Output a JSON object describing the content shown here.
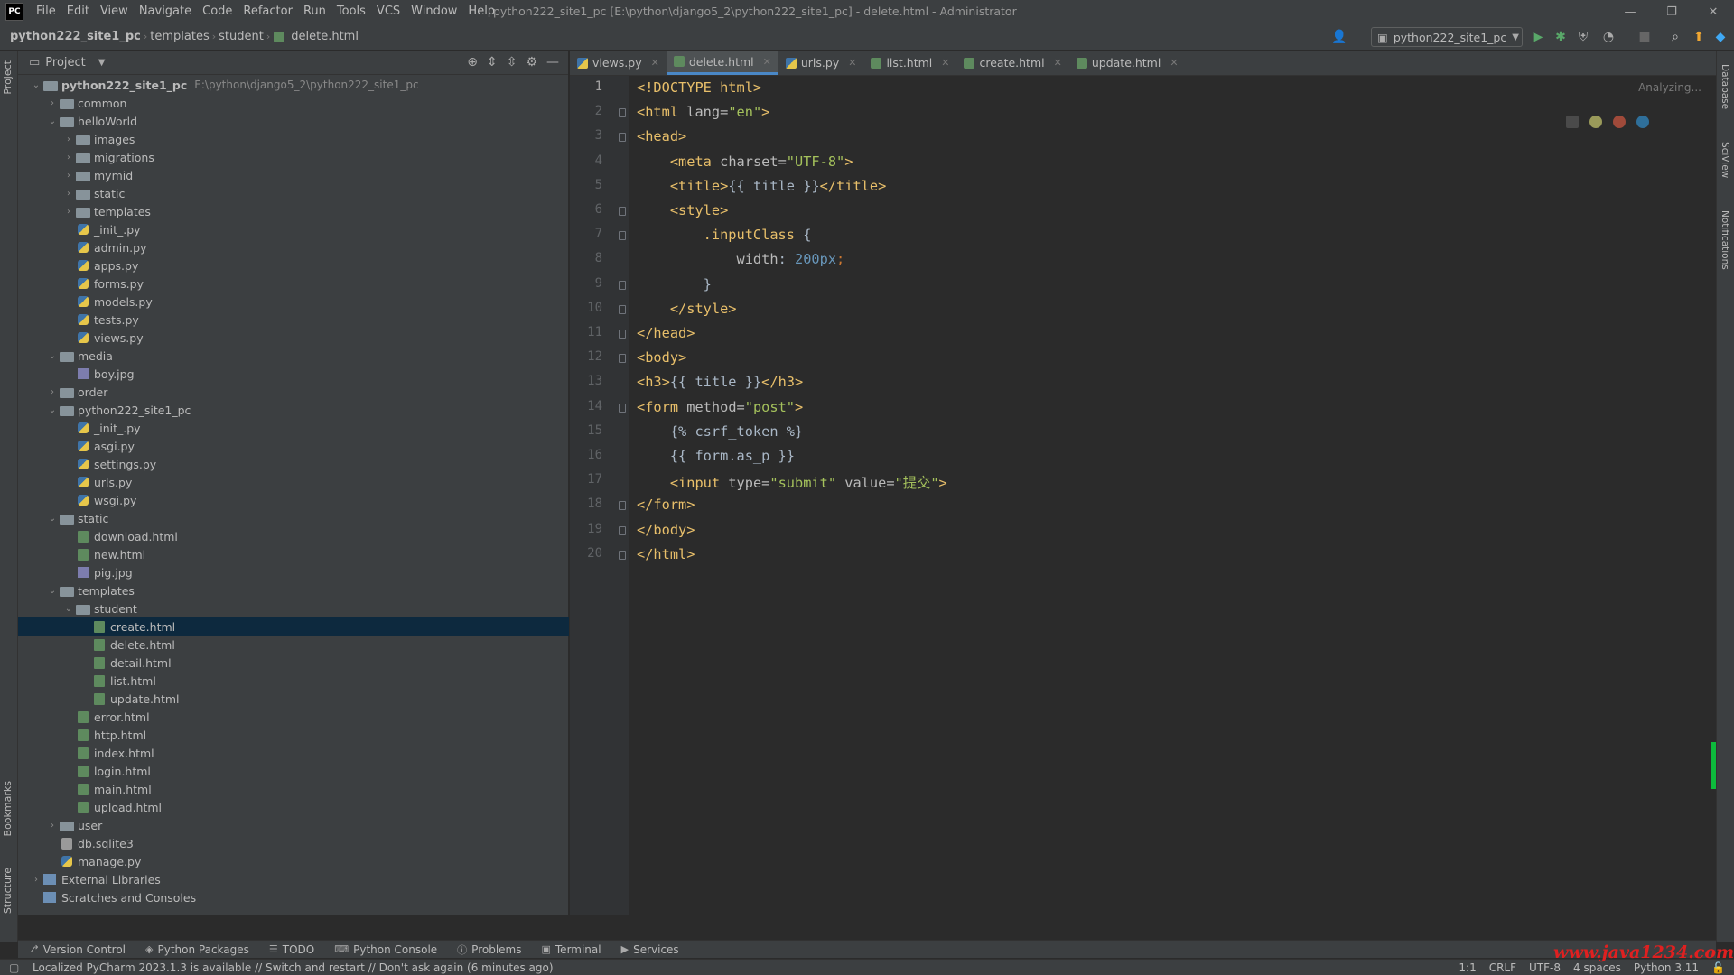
{
  "titlebar": {
    "logo": "PC",
    "menu": [
      "File",
      "Edit",
      "View",
      "Navigate",
      "Code",
      "Refactor",
      "Run",
      "Tools",
      "VCS",
      "Window",
      "Help"
    ],
    "window_title": "python222_site1_pc [E:\\python\\django5_2\\python222_site1_pc] - delete.html - Administrator"
  },
  "navbar": {
    "crumbs": [
      "python222_site1_pc",
      "templates",
      "student",
      "delete.html"
    ],
    "run_config": "python222_site1_pc"
  },
  "project": {
    "title": "Project",
    "tree": [
      {
        "depth": 0,
        "arrow": "down",
        "type": "folder",
        "label": "python222_site1_pc",
        "hint": "E:\\python\\django5_2\\python222_site1_pc",
        "bold": true
      },
      {
        "depth": 1,
        "arrow": "right",
        "type": "folder",
        "label": "common"
      },
      {
        "depth": 1,
        "arrow": "down",
        "type": "folder",
        "label": "helloWorld"
      },
      {
        "depth": 2,
        "arrow": "right",
        "type": "folder",
        "label": "images"
      },
      {
        "depth": 2,
        "arrow": "right",
        "type": "folder",
        "label": "migrations"
      },
      {
        "depth": 2,
        "arrow": "right",
        "type": "folder",
        "label": "mymid"
      },
      {
        "depth": 2,
        "arrow": "right",
        "type": "folder",
        "label": "static"
      },
      {
        "depth": 2,
        "arrow": "right",
        "type": "folder",
        "label": "templates"
      },
      {
        "depth": 2,
        "arrow": "",
        "type": "py",
        "label": "_init_.py"
      },
      {
        "depth": 2,
        "arrow": "",
        "type": "py",
        "label": "admin.py"
      },
      {
        "depth": 2,
        "arrow": "",
        "type": "py",
        "label": "apps.py"
      },
      {
        "depth": 2,
        "arrow": "",
        "type": "py",
        "label": "forms.py"
      },
      {
        "depth": 2,
        "arrow": "",
        "type": "py",
        "label": "models.py"
      },
      {
        "depth": 2,
        "arrow": "",
        "type": "py",
        "label": "tests.py"
      },
      {
        "depth": 2,
        "arrow": "",
        "type": "py",
        "label": "views.py"
      },
      {
        "depth": 1,
        "arrow": "down",
        "type": "folder",
        "label": "media"
      },
      {
        "depth": 2,
        "arrow": "",
        "type": "jpg",
        "label": "boy.jpg"
      },
      {
        "depth": 1,
        "arrow": "right",
        "type": "folder",
        "label": "order"
      },
      {
        "depth": 1,
        "arrow": "down",
        "type": "folder",
        "label": "python222_site1_pc"
      },
      {
        "depth": 2,
        "arrow": "",
        "type": "py",
        "label": "_init_.py"
      },
      {
        "depth": 2,
        "arrow": "",
        "type": "py",
        "label": "asgi.py"
      },
      {
        "depth": 2,
        "arrow": "",
        "type": "py",
        "label": "settings.py"
      },
      {
        "depth": 2,
        "arrow": "",
        "type": "py",
        "label": "urls.py"
      },
      {
        "depth": 2,
        "arrow": "",
        "type": "py",
        "label": "wsgi.py"
      },
      {
        "depth": 1,
        "arrow": "down",
        "type": "folder",
        "label": "static"
      },
      {
        "depth": 2,
        "arrow": "",
        "type": "html",
        "label": "download.html"
      },
      {
        "depth": 2,
        "arrow": "",
        "type": "html",
        "label": "new.html"
      },
      {
        "depth": 2,
        "arrow": "",
        "type": "jpg",
        "label": "pig.jpg"
      },
      {
        "depth": 1,
        "arrow": "down",
        "type": "folder",
        "label": "templates"
      },
      {
        "depth": 2,
        "arrow": "down",
        "type": "folder",
        "label": "student"
      },
      {
        "depth": 3,
        "arrow": "",
        "type": "html",
        "label": "create.html",
        "selected": true
      },
      {
        "depth": 3,
        "arrow": "",
        "type": "html",
        "label": "delete.html"
      },
      {
        "depth": 3,
        "arrow": "",
        "type": "html",
        "label": "detail.html"
      },
      {
        "depth": 3,
        "arrow": "",
        "type": "html",
        "label": "list.html"
      },
      {
        "depth": 3,
        "arrow": "",
        "type": "html",
        "label": "update.html"
      },
      {
        "depth": 2,
        "arrow": "",
        "type": "html",
        "label": "error.html"
      },
      {
        "depth": 2,
        "arrow": "",
        "type": "html",
        "label": "http.html"
      },
      {
        "depth": 2,
        "arrow": "",
        "type": "html",
        "label": "index.html"
      },
      {
        "depth": 2,
        "arrow": "",
        "type": "html",
        "label": "login.html"
      },
      {
        "depth": 2,
        "arrow": "",
        "type": "html",
        "label": "main.html"
      },
      {
        "depth": 2,
        "arrow": "",
        "type": "html",
        "label": "upload.html"
      },
      {
        "depth": 1,
        "arrow": "right",
        "type": "folder",
        "label": "user"
      },
      {
        "depth": 1,
        "arrow": "",
        "type": "db",
        "label": "db.sqlite3"
      },
      {
        "depth": 1,
        "arrow": "",
        "type": "py",
        "label": "manage.py"
      },
      {
        "depth": 0,
        "arrow": "right",
        "type": "lib",
        "label": "External Libraries"
      },
      {
        "depth": 0,
        "arrow": "",
        "type": "lib",
        "label": "Scratches and Consoles"
      }
    ]
  },
  "tabs": [
    {
      "label": "views.py",
      "type": "py",
      "active": false
    },
    {
      "label": "delete.html",
      "type": "html",
      "active": true
    },
    {
      "label": "urls.py",
      "type": "py",
      "active": false
    },
    {
      "label": "list.html",
      "type": "html",
      "active": false
    },
    {
      "label": "create.html",
      "type": "html",
      "active": false
    },
    {
      "label": "update.html",
      "type": "html",
      "active": false
    }
  ],
  "editor": {
    "analyzing": "Analyzing...",
    "lines": [
      [
        [
          "tag",
          "<!DOCTYPE html>"
        ]
      ],
      [
        [
          "tag",
          "<html "
        ],
        [
          "attr",
          "lang="
        ],
        [
          "str",
          "\"en\""
        ],
        [
          "tag",
          ">"
        ]
      ],
      [
        [
          "tag",
          "<head>"
        ]
      ],
      [
        [
          "tag",
          "    <meta "
        ],
        [
          "attr",
          "charset="
        ],
        [
          "str",
          "\"UTF-8\""
        ],
        [
          "tag",
          ">"
        ]
      ],
      [
        [
          "tag",
          "    <title>"
        ],
        [
          "tpl",
          "{{ title }}"
        ],
        [
          "tag",
          "</title>"
        ]
      ],
      [
        [
          "tag",
          "    <style>"
        ]
      ],
      [
        [
          "cls",
          "        .inputClass "
        ],
        [
          "tpl",
          "{"
        ]
      ],
      [
        [
          "attr",
          "            width"
        ],
        [
          "tpl",
          ": "
        ],
        [
          "num",
          "200px"
        ],
        [
          "kw",
          ";"
        ]
      ],
      [
        [
          "tpl",
          "        }"
        ]
      ],
      [
        [
          "tag",
          "    </style>"
        ]
      ],
      [
        [
          "tag",
          "</head>"
        ]
      ],
      [
        [
          "tag",
          "<body>"
        ]
      ],
      [
        [
          "tag",
          "<h3>"
        ],
        [
          "tpl",
          "{{ title }}"
        ],
        [
          "tag",
          "</h3>"
        ]
      ],
      [
        [
          "tag",
          "<form "
        ],
        [
          "attr",
          "method="
        ],
        [
          "str",
          "\"post\""
        ],
        [
          "tag",
          ">"
        ]
      ],
      [
        [
          "tpl",
          "    {% csrf_token %}"
        ]
      ],
      [
        [
          "tpl",
          "    {{ form.as_p }}"
        ]
      ],
      [
        [
          "tag",
          "    <input "
        ],
        [
          "attr",
          "type="
        ],
        [
          "str",
          "\"submit\""
        ],
        [
          "attr",
          " value="
        ],
        [
          "str",
          "\"提交\""
        ],
        [
          "tag",
          ">"
        ]
      ],
      [
        [
          "tag",
          "</form>"
        ]
      ],
      [
        [
          "tag",
          "</body>"
        ]
      ],
      [
        [
          "tag",
          "</html>"
        ]
      ]
    ]
  },
  "left_tools": [
    "Project",
    "Bookmarks",
    "Structure"
  ],
  "right_tools": [
    "Database",
    "SciView",
    "Notifications"
  ],
  "bottom_tools": [
    {
      "label": "Version Control",
      "icon": "branch-icon"
    },
    {
      "label": "Python Packages",
      "icon": "package-icon"
    },
    {
      "label": "TODO",
      "icon": "list-icon"
    },
    {
      "label": "Python Console",
      "icon": "console-icon"
    },
    {
      "label": "Problems",
      "icon": "problems-icon"
    },
    {
      "label": "Terminal",
      "icon": "terminal-icon"
    },
    {
      "label": "Services",
      "icon": "services-icon"
    }
  ],
  "status": {
    "message": "Localized PyCharm 2023.1.3 is available // Switch and restart // Don't ask again (6 minutes ago)",
    "caret": "1:1",
    "line_sep": "CRLF",
    "encoding": "UTF-8",
    "indent": "4 spaces",
    "interpreter": "Python 3.11"
  },
  "watermark": "www.java1234.com",
  "colors": {
    "accent": "#4a88c7",
    "selection": "#0d293e",
    "scroll_marker": "#0dbb3c"
  }
}
